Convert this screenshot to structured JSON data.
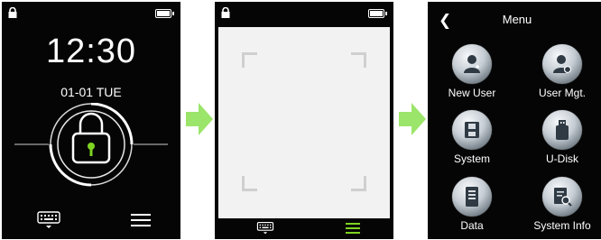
{
  "screen1": {
    "time": "12:30",
    "date": "01-01 TUE",
    "battery_level": 1.0
  },
  "screen2": {
    "battery_level": 1.0
  },
  "screen3": {
    "back_icon": "chevron-left-icon",
    "title": "Menu",
    "items": [
      {
        "label": "New User",
        "icon": "add-user-icon"
      },
      {
        "label": "User Mgt.",
        "icon": "user-settings-icon"
      },
      {
        "label": "System",
        "icon": "floppy-disk-icon"
      },
      {
        "label": "U-Disk",
        "icon": "usb-drive-icon"
      },
      {
        "label": "Data",
        "icon": "server-icon"
      },
      {
        "label": "System Info",
        "icon": "document-search-icon"
      }
    ]
  },
  "colors": {
    "accent_green": "#7ed321",
    "arrow_green": "#9be56a",
    "screen_bg": "#050505",
    "scan_bg": "#f2f2f2"
  }
}
